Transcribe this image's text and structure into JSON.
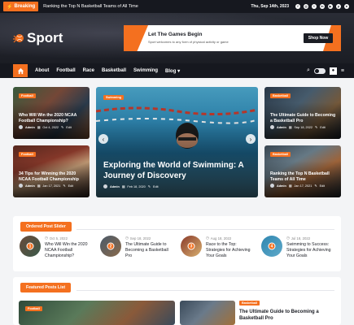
{
  "topbar": {
    "breaking_label": "Breaking",
    "ticker": "Ranking the Top N Basketball Teams of All Time",
    "date": "Thu, Sep 14th, 2023",
    "social_icons": [
      "facebook-icon",
      "instagram-icon",
      "twitter-icon",
      "linkedin-icon",
      "youtube-icon",
      "pinterest-icon",
      "telegram-icon"
    ]
  },
  "header": {
    "logo_text": "Sport",
    "banner": {
      "title": "Let The Games Begin",
      "subtitle": "Sport welcomes to any form of physical activity or game",
      "button": "Shop Now"
    }
  },
  "nav": {
    "items": [
      "About",
      "Football",
      "Race",
      "Basketball",
      "Swimming",
      "Blog"
    ],
    "blog_caret": "▾"
  },
  "grid": {
    "top_left": {
      "category": "Football",
      "title": "Who Will Win the 2020 NCAA Football Championship?",
      "author": "Admin",
      "date": "Oct 4, 2022",
      "edit": "Edit"
    },
    "bottom_left": {
      "category": "Football",
      "title": "34 Tips for Winning the 2020 NCAA Football Championship",
      "author": "Admin",
      "date": "Jan 17, 2021",
      "edit": "Edit"
    },
    "center": {
      "category": "Swimming",
      "title": "Exploring the World of Swimming: A Journey of Discovery",
      "author": "Admin",
      "date": "Feb 18, 2020",
      "edit": "Edit"
    },
    "top_right": {
      "category": "Basketball",
      "title": "The Ultimate Guide to Becoming a Basketball Pro",
      "author": "Admin",
      "date": "Sep 18, 2022",
      "edit": "Edit"
    },
    "bottom_right": {
      "category": "Basketball",
      "title": "Ranking the Top N Basketball Teams of All Time",
      "author": "Admin",
      "date": "Jan 17, 2021",
      "edit": "Edit"
    }
  },
  "ordered_slider": {
    "heading": "Ordered Post Slider",
    "posts": [
      {
        "num": "1",
        "date": "Oct 5, 2022",
        "title": "Who Will Win the 2020 NCAA Football Championship?"
      },
      {
        "num": "2",
        "date": "Sep 18, 2022",
        "title": "The Ultimate Guide to Becoming a Basketball Pro"
      },
      {
        "num": "3",
        "date": "Aug 18, 2022",
        "title": "Race to the Top: Strategies for Achieving Your Goals"
      },
      {
        "num": "4",
        "date": "Jul 18, 2022",
        "title": "Swimming to Success: Strategies for Achieving Your Goals"
      }
    ]
  },
  "featured_list": {
    "heading": "Featured Posts List",
    "left_category": "Football",
    "right_category": "Basketball",
    "right_title": "The Ultimate Guide to Becoming a Basketball Pro"
  },
  "colors": {
    "accent": "#f4701f",
    "dark": "#16181f",
    "page_bg": "#f3f4f6"
  }
}
